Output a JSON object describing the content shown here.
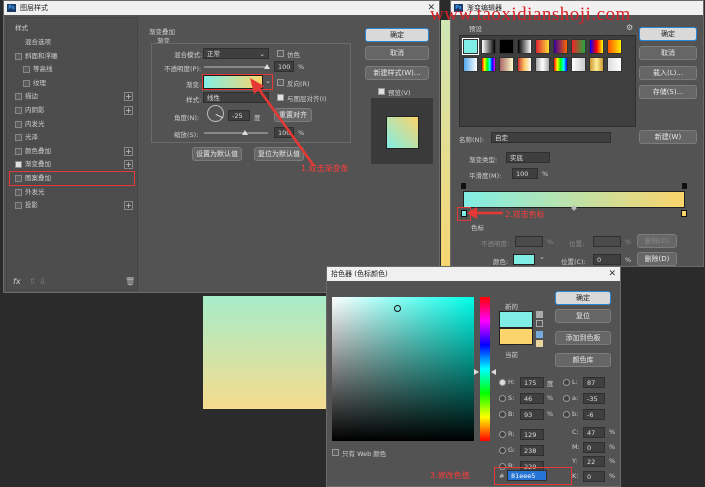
{
  "watermark": "www.taoxidianshoji.com",
  "layer_style": {
    "title": "图层样式",
    "sidebar_header": "样式",
    "sidebar_items": [
      {
        "label": "混合选项",
        "check": false,
        "plus": false,
        "indent": false
      },
      {
        "label": "斜面和浮雕",
        "check": true,
        "plus": false,
        "indent": false
      },
      {
        "label": "等高线",
        "check": true,
        "plus": false,
        "indent": true
      },
      {
        "label": "纹理",
        "check": true,
        "plus": false,
        "indent": true
      },
      {
        "label": "描边",
        "check": true,
        "plus": true,
        "indent": false
      },
      {
        "label": "内阴影",
        "check": true,
        "plus": true,
        "indent": false
      },
      {
        "label": "内发光",
        "check": true,
        "plus": false,
        "indent": false
      },
      {
        "label": "光泽",
        "check": true,
        "plus": false,
        "indent": false
      },
      {
        "label": "颜色叠加",
        "check": true,
        "plus": true,
        "indent": false
      },
      {
        "label": "渐变叠加",
        "check": true,
        "plus": true,
        "indent": false
      },
      {
        "label": "图案叠加",
        "check": true,
        "plus": false,
        "indent": false
      },
      {
        "label": "外发光",
        "check": true,
        "plus": false,
        "indent": false
      },
      {
        "label": "投影",
        "check": true,
        "plus": true,
        "indent": false
      }
    ],
    "section_title": "渐变叠加",
    "section_sub": "渐变",
    "blend_mode_label": "混合模式:",
    "blend_mode_value": "正常",
    "dither_label": "仿色",
    "opacity_label": "不透明度(P):",
    "opacity_value": "100",
    "pct": "%",
    "gradient_label": "渐变:",
    "reverse_label": "反向(R)",
    "style_label": "样式:",
    "style_value": "线性",
    "align_label": "与图层对齐(I)",
    "angle_label": "角度(N):",
    "angle_value": "-25",
    "deg": "度",
    "reset_align": "重置对齐",
    "scale_label": "缩放(S):",
    "scale_value": "100",
    "set_default": "设置为默认值",
    "reset_default": "复位为默认值",
    "ok": "确定",
    "cancel": "取消",
    "new_style": "新建样式(W)...",
    "preview_label": "预览(V)",
    "fx": "fx"
  },
  "gradient_editor": {
    "title": "渐变编辑器",
    "presets_label": "预设",
    "ok": "确定",
    "cancel": "取消",
    "load": "载入(L)...",
    "save": "存储(S)...",
    "name_label": "名称(N):",
    "name_value": "自定",
    "new_btn": "新建(W)",
    "type_label": "渐变类型:",
    "type_value": "实底",
    "smooth_label": "平滑度(M):",
    "smooth_value": "100",
    "pct": "%",
    "stops_label": "色标",
    "opacity_label": "不透明度:",
    "location_label": "位置:",
    "delete_label": "删除(D)",
    "color_label": "颜色:",
    "location_c_label": "位置(C):",
    "location_c_value": "0",
    "delete_c_label": "删除(D)",
    "color_start": "#81eee5",
    "color_end": "#fbd46b"
  },
  "color_picker": {
    "title": "拾色器 (色标颜色)",
    "new_label": "新的",
    "current_label": "当前",
    "ok": "确定",
    "reset": "复位",
    "add_swatch": "添加到色板",
    "color_lib": "颜色库",
    "web_only": "只有 Web 颜色",
    "fields_left": [
      {
        "k": "H:",
        "v": "175",
        "u": "度",
        "radio": true
      },
      {
        "k": "S:",
        "v": "46",
        "u": "%",
        "radio": false
      },
      {
        "k": "B:",
        "v": "93",
        "u": "%",
        "radio": false
      },
      {
        "k": "R:",
        "v": "129",
        "u": "",
        "radio": false
      },
      {
        "k": "G:",
        "v": "238",
        "u": "",
        "radio": false
      },
      {
        "k": "B:",
        "v": "229",
        "u": "",
        "radio": false
      }
    ],
    "fields_right": [
      {
        "k": "L:",
        "v": "87",
        "u": ""
      },
      {
        "k": "a:",
        "v": "-35",
        "u": ""
      },
      {
        "k": "b:",
        "v": "-6",
        "u": ""
      },
      {
        "k": "C:",
        "v": "47",
        "u": "%"
      },
      {
        "k": "M:",
        "v": "0",
        "u": "%"
      },
      {
        "k": "Y:",
        "v": "22",
        "u": "%"
      },
      {
        "k": "K:",
        "v": "0",
        "u": "%"
      }
    ],
    "hash": "#",
    "hex_value": "81eee5",
    "new_color": "#81eee5",
    "current_color": "#fbd46b"
  },
  "annotations": {
    "step1": "1.双击渐变条",
    "step2": "2.双击色标",
    "step3": "3.修改色值"
  }
}
